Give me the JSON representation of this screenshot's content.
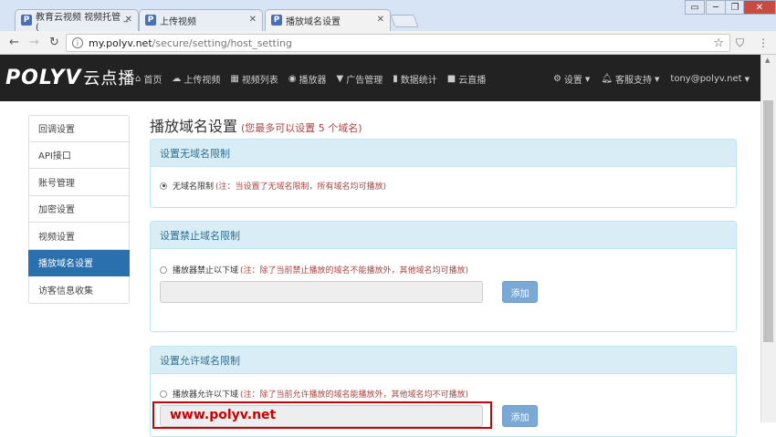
{
  "browser": {
    "tabs": [
      {
        "label": "教育云视频 视频托管 _ (",
        "favicon": "P"
      },
      {
        "label": "上传视频",
        "favicon": "P"
      },
      {
        "label": "播放域名设置",
        "favicon": "P"
      }
    ],
    "url_host": "my.polyv.net",
    "url_path": "/secure/setting/host_setting"
  },
  "site": {
    "logo": "POLYV",
    "logo_cn": "云点播",
    "nav": [
      {
        "icon": "home-icon",
        "glyph": "⌂",
        "label": "首页"
      },
      {
        "icon": "upload-icon",
        "glyph": "☁",
        "label": "上传视频"
      },
      {
        "icon": "film-icon",
        "glyph": "▦",
        "label": "视频列表"
      },
      {
        "icon": "play-icon",
        "glyph": "◉",
        "label": "播放器"
      },
      {
        "icon": "filter-icon",
        "glyph": "▼",
        "label": "广告管理"
      },
      {
        "icon": "chart-icon",
        "glyph": "▮",
        "label": "数据统计"
      },
      {
        "icon": "camera-icon",
        "glyph": "■",
        "label": "云直播"
      }
    ],
    "nav_right": [
      {
        "icon": "gear-icon",
        "glyph": "⚙",
        "label": "设置"
      },
      {
        "icon": "bell-icon",
        "glyph": "♠",
        "label": "客服支持"
      },
      {
        "icon": "",
        "glyph": "",
        "label": "tony@polyv.net"
      }
    ]
  },
  "sidebar": {
    "items": [
      {
        "label": "回调设置",
        "active": false
      },
      {
        "label": "API接口",
        "active": false
      },
      {
        "label": "账号管理",
        "active": false
      },
      {
        "label": "加密设置",
        "active": false
      },
      {
        "label": "视频设置",
        "active": false
      },
      {
        "label": "播放域名设置",
        "active": true
      },
      {
        "label": "访客信息收集",
        "active": false
      }
    ]
  },
  "main": {
    "title": "播放域名设置",
    "title_hint": "(您最多可以设置 5 个域名)",
    "panels": {
      "none": {
        "heading": "设置无域名限制",
        "option": "无域名限制",
        "note": "(注：当设置了无域名限制，所有域名均可播放)",
        "checked": true
      },
      "deny": {
        "heading": "设置禁止域名限制",
        "option": "播放器禁止以下域",
        "note": "(注：除了当前禁止播放的域名不能播放外，其他域名均可播放)",
        "checked": false,
        "button": "添加"
      },
      "allow": {
        "heading": "设置允许域名限制",
        "option": "播放器允许以下域",
        "note": "(注：除了当前允许播放的域名能播放外，其他域名均不可播放)",
        "checked": false,
        "button": "添加",
        "value": "www.polyv.net"
      }
    }
  },
  "colors": {
    "accent": "#2a6fae",
    "nav_bg": "#222222",
    "panel_head": "#d9edf7",
    "warning": "#a94442",
    "highlight": "#cc0000"
  }
}
